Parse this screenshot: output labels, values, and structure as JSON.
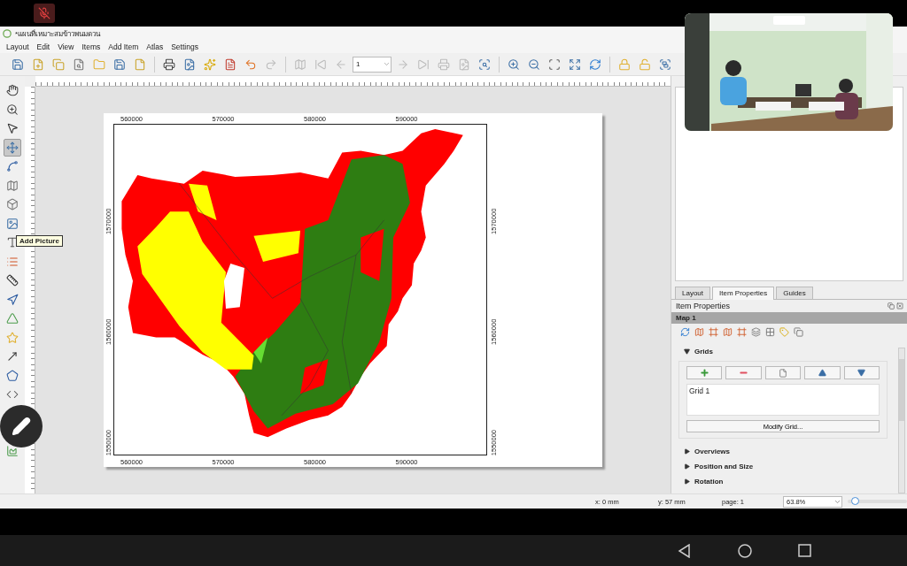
{
  "window": {
    "title": "*แผนที่เหมาะสมข้าวพนมดวน"
  },
  "menu": [
    "Layout",
    "Edit",
    "View",
    "Items",
    "Add Item",
    "Atlas",
    "Settings"
  ],
  "toolbar": {
    "page_field": "1"
  },
  "left_tools": [
    {
      "kind": "pan",
      "selected": false
    },
    {
      "kind": "zoom",
      "selected": false
    },
    {
      "kind": "select",
      "selected": false
    },
    {
      "kind": "move-content",
      "selected": true
    },
    {
      "kind": "edit-nodes",
      "selected": false
    },
    {
      "kind": "add-map",
      "selected": false
    },
    {
      "kind": "add-3d",
      "selected": false
    },
    {
      "kind": "add-picture",
      "selected": false
    },
    {
      "kind": "add-label",
      "selected": false
    },
    {
      "kind": "add-legend",
      "selected": false
    },
    {
      "kind": "add-scalebar",
      "selected": false
    },
    {
      "kind": "add-north-arrow",
      "selected": false
    },
    {
      "kind": "add-shape",
      "selected": false
    },
    {
      "kind": "add-marker",
      "selected": false
    },
    {
      "kind": "add-arrow",
      "selected": false
    },
    {
      "kind": "add-polygon",
      "selected": false
    },
    {
      "kind": "add-html",
      "selected": false
    }
  ],
  "left_tools_lower": [
    {
      "kind": "add-chart",
      "selected": false
    }
  ],
  "tooltip": "Add Picture",
  "map": {
    "top_ticks": [
      "560000",
      "570000",
      "580000",
      "590000"
    ],
    "bottom_ticks": [
      "560000",
      "570000",
      "580000",
      "590000"
    ],
    "left_ticks": [
      "1570000",
      "1560000",
      "1550000"
    ],
    "right_ticks": [
      "1570000",
      "1560000",
      "1550000"
    ]
  },
  "panel": {
    "tabs": [
      {
        "label": "Layout",
        "selected": false
      },
      {
        "label": "Item Properties",
        "selected": true
      },
      {
        "label": "Guides",
        "selected": false
      }
    ],
    "title": "Item Properties",
    "item": "Map 1",
    "grids": [
      "Grid 1"
    ],
    "modify_button": "Modify Grid...",
    "sections": [
      {
        "label": "Grids",
        "expanded": true
      },
      {
        "label": "Overviews",
        "expanded": false
      },
      {
        "label": "Position and Size",
        "expanded": false
      },
      {
        "label": "Rotation",
        "expanded": false
      }
    ]
  },
  "status_bar": {
    "x": "x: 0 mm",
    "y": "y: 57 mm",
    "page": "page: 1",
    "zoom": "63.8%",
    "zoom_slider": {
      "level": 0.06
    }
  }
}
